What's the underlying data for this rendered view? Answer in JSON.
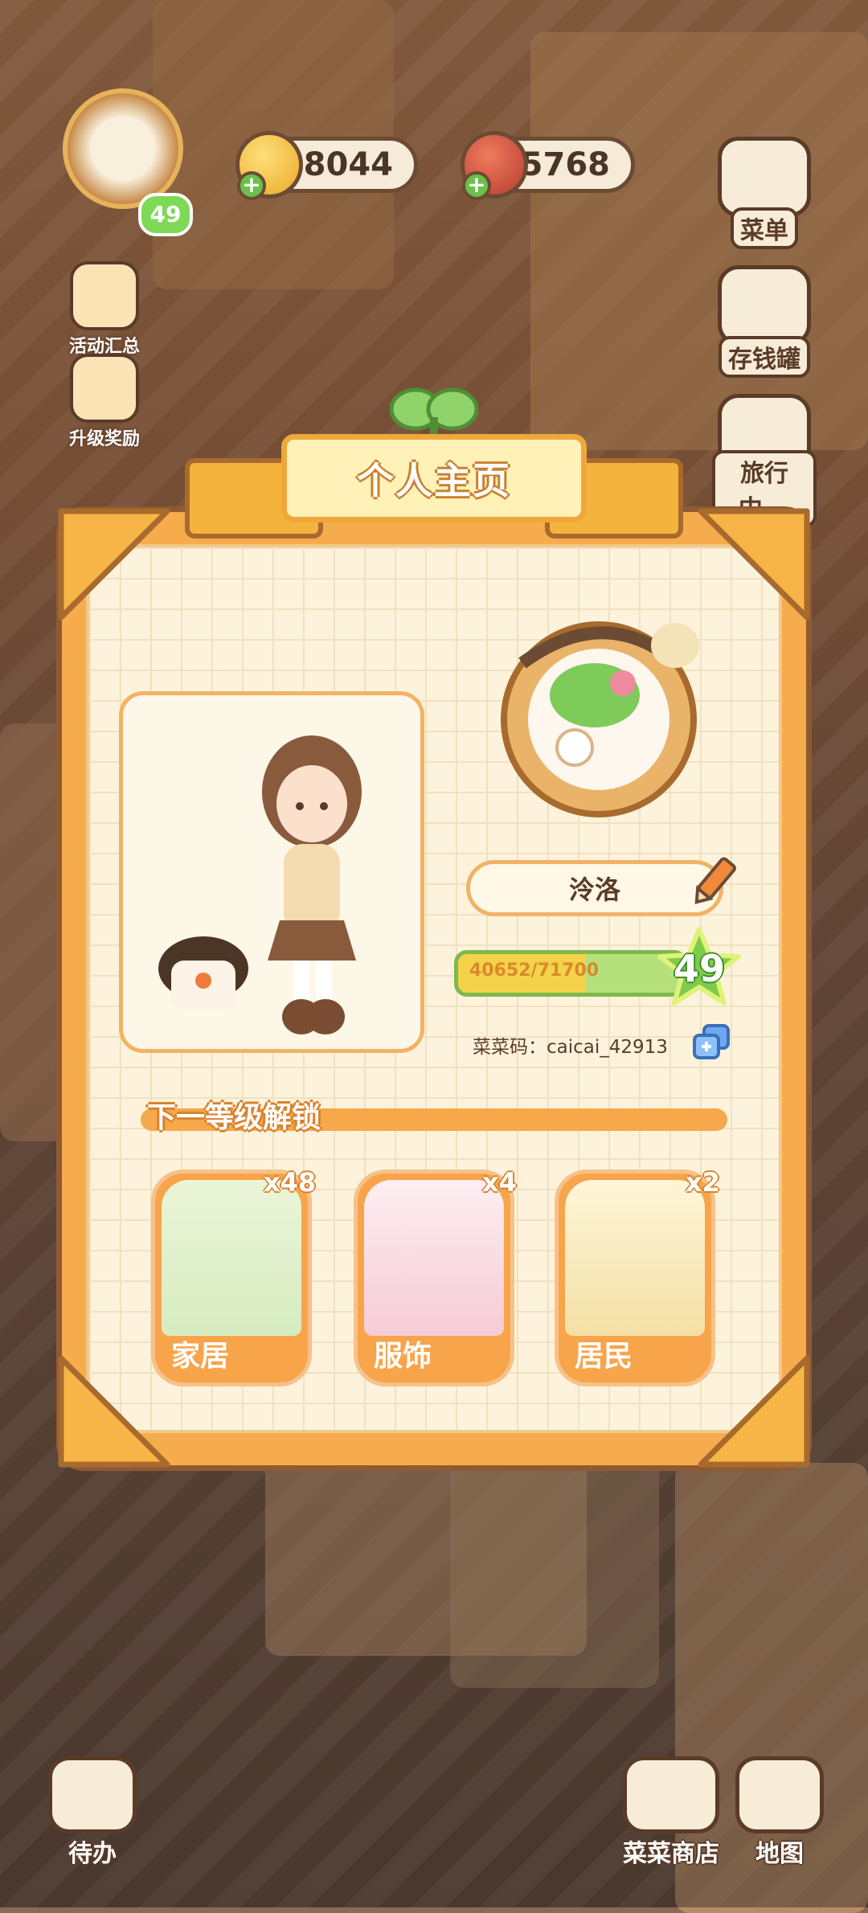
{
  "hud": {
    "coins": "8044",
    "meat": "5768",
    "player_level": "49"
  },
  "left_menu": [
    {
      "label": "活动汇总"
    },
    {
      "label": "升级奖励"
    }
  ],
  "right_menu": [
    {
      "label": "菜单"
    },
    {
      "label": "存钱罐"
    },
    {
      "label": "旅行中..."
    }
  ],
  "profile": {
    "title": "个人主页",
    "name": "泠洛",
    "xp_text": "40652/71700",
    "xp_fraction": 0.567,
    "level": "49",
    "code_label": "菜菜码：",
    "code_value": "caicai_42913"
  },
  "unlock": {
    "heading": "下一等级解锁",
    "items": [
      {
        "label": "家居",
        "count": "x48"
      },
      {
        "label": "服饰",
        "count": "x4"
      },
      {
        "label": "居民",
        "count": "x2"
      }
    ]
  },
  "bottom_nav": {
    "todo": "待办",
    "shop": "菜菜商店",
    "map": "地图"
  },
  "colors": {
    "panel": "#f6ab4d",
    "panel_border": "#8f5a33",
    "xp_bar": "#b5e07a",
    "accent_text": "#d9822e"
  }
}
